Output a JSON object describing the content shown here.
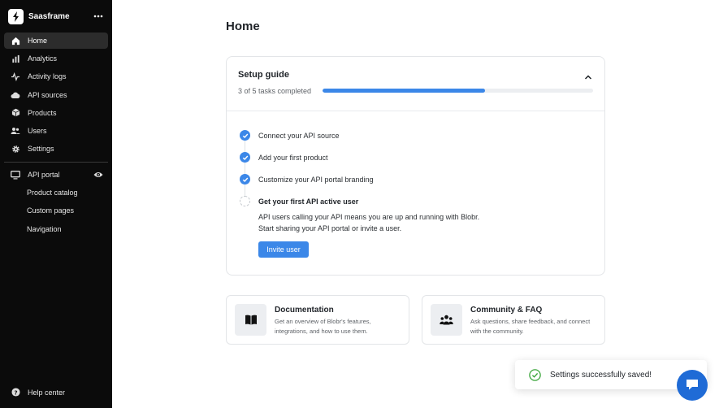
{
  "brand": {
    "name": "Saasframe",
    "logo_icon": "lightning-s-icon",
    "more_icon": "more-horizontal-icon"
  },
  "sidebar": {
    "items": [
      {
        "label": "Home",
        "icon": "home-icon",
        "active": true
      },
      {
        "label": "Analytics",
        "icon": "bar-chart-icon"
      },
      {
        "label": "Activity logs",
        "icon": "activity-icon"
      },
      {
        "label": "API sources",
        "icon": "cloud-icon"
      },
      {
        "label": "Products",
        "icon": "box-icon"
      },
      {
        "label": "Users",
        "icon": "users-icon"
      },
      {
        "label": "Settings",
        "icon": "gear-icon"
      }
    ],
    "portal": {
      "label": "API portal",
      "icon": "monitor-icon",
      "view_icon": "eye-icon",
      "sub_items": [
        {
          "label": "Product catalog"
        },
        {
          "label": "Custom pages"
        },
        {
          "label": "Navigation"
        }
      ]
    },
    "help": {
      "label": "Help center",
      "icon": "help-circle-icon"
    }
  },
  "main": {
    "title": "Home",
    "setup": {
      "title": "Setup guide",
      "progress_text": "3 of 5 tasks completed",
      "progress_fraction": 0.6,
      "tasks": [
        {
          "label": "Connect your API source",
          "done": true
        },
        {
          "label": "Add your first product",
          "done": true
        },
        {
          "label": "Customize your API portal branding",
          "done": true
        },
        {
          "label": "Get your first API active user",
          "done": false
        }
      ],
      "desc_line1": "API users calling your API means you are up and running with Blobr.",
      "desc_line2": "Start sharing your API portal or invite a user.",
      "button": "Invite user"
    },
    "tiles": [
      {
        "title": "Documentation",
        "desc": "Get an overview of Blobr's features, integrations, and how to use them.",
        "icon": "book-icon"
      },
      {
        "title": "Community & FAQ",
        "desc": "Ask questions, share feedback, and connect with the community.",
        "icon": "community-icon"
      }
    ]
  },
  "toast": {
    "text": "Settings successfully saved!",
    "icon": "check-circle-icon"
  },
  "colors": {
    "accent": "#3b87e8",
    "sidebar_bg": "#0b0b0b",
    "success": "#3aa53a",
    "chat": "#1f6bd6"
  }
}
